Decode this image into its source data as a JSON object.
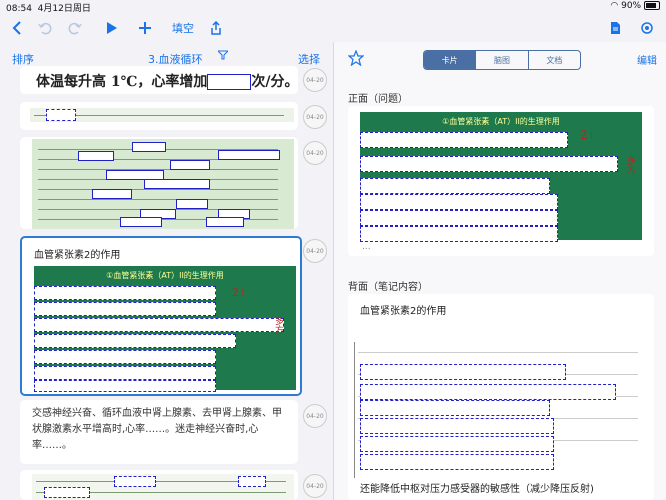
{
  "status": {
    "time": "08:54",
    "date": "4月12日周日",
    "battery": "90%"
  },
  "toolbar": {
    "fill_label": "填空"
  },
  "list_header": {
    "sort": "排序",
    "deck": "3.血液循环",
    "select": "选择"
  },
  "cards": {
    "c1_text": "体温每升高 1℃，心率增加",
    "c1_suffix": "次/分。",
    "c4_title": "血管紧张素2的作用",
    "c4_green_title": "①血管紧张素（AT）II的生理作用",
    "c5_text1": "交感神经兴奋、循环血液中肾上腺素、去甲肾上腺素、甲状腺激素水平增高时,心率……。迷走神经兴奋时,心率……。",
    "date_label": "04-20"
  },
  "right": {
    "tabs": [
      "卡片",
      "脑图",
      "文档"
    ],
    "edit": "编辑",
    "front_label": "正面（问题）",
    "back_label": "背面（笔记内容）",
    "green_title": "①血管紧张素（AT）II的生理作用",
    "ellipsis": "...",
    "back_title": "血管紧张素2的作用",
    "bottom_text": "还能降低中枢对压力感受器的敏感性（减少降压反射)"
  }
}
